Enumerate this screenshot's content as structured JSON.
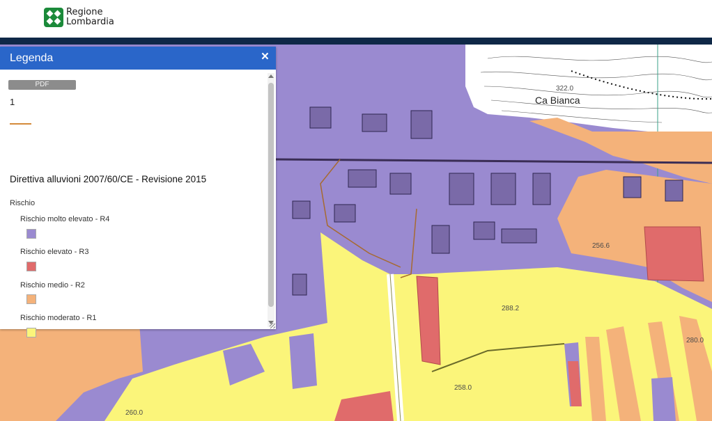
{
  "header": {
    "logo_line1": "Regione",
    "logo_line2": "Lombardia",
    "logo_color": "#1b8a3a",
    "band_color": "#0f2847"
  },
  "legend": {
    "title": "Legenda",
    "close_glyph": "×",
    "pdf_label": "PDF",
    "layer_number": "1",
    "line_color": "#d48a3a",
    "section_title": "Direttiva alluvioni 2007/60/CE - Revisione 2015",
    "group_title": "Rischio",
    "entries": [
      {
        "label": "Rischio molto elevato - R4",
        "color": "#9a8ad0"
      },
      {
        "label": "Rischio elevato - R3",
        "color": "#e06b6b"
      },
      {
        "label": "Rischio medio - R2",
        "color": "#f4b27a"
      },
      {
        "label": "Rischio moderato - R1",
        "color": "#fbf57a"
      }
    ]
  },
  "map": {
    "labels": {
      "place": "Ca Bianca",
      "elev1": "288.2",
      "elev2": "256.6",
      "elev3": "258.0",
      "elev4": "280.0",
      "elev5": "260.0",
      "elev6": "322.0"
    }
  }
}
